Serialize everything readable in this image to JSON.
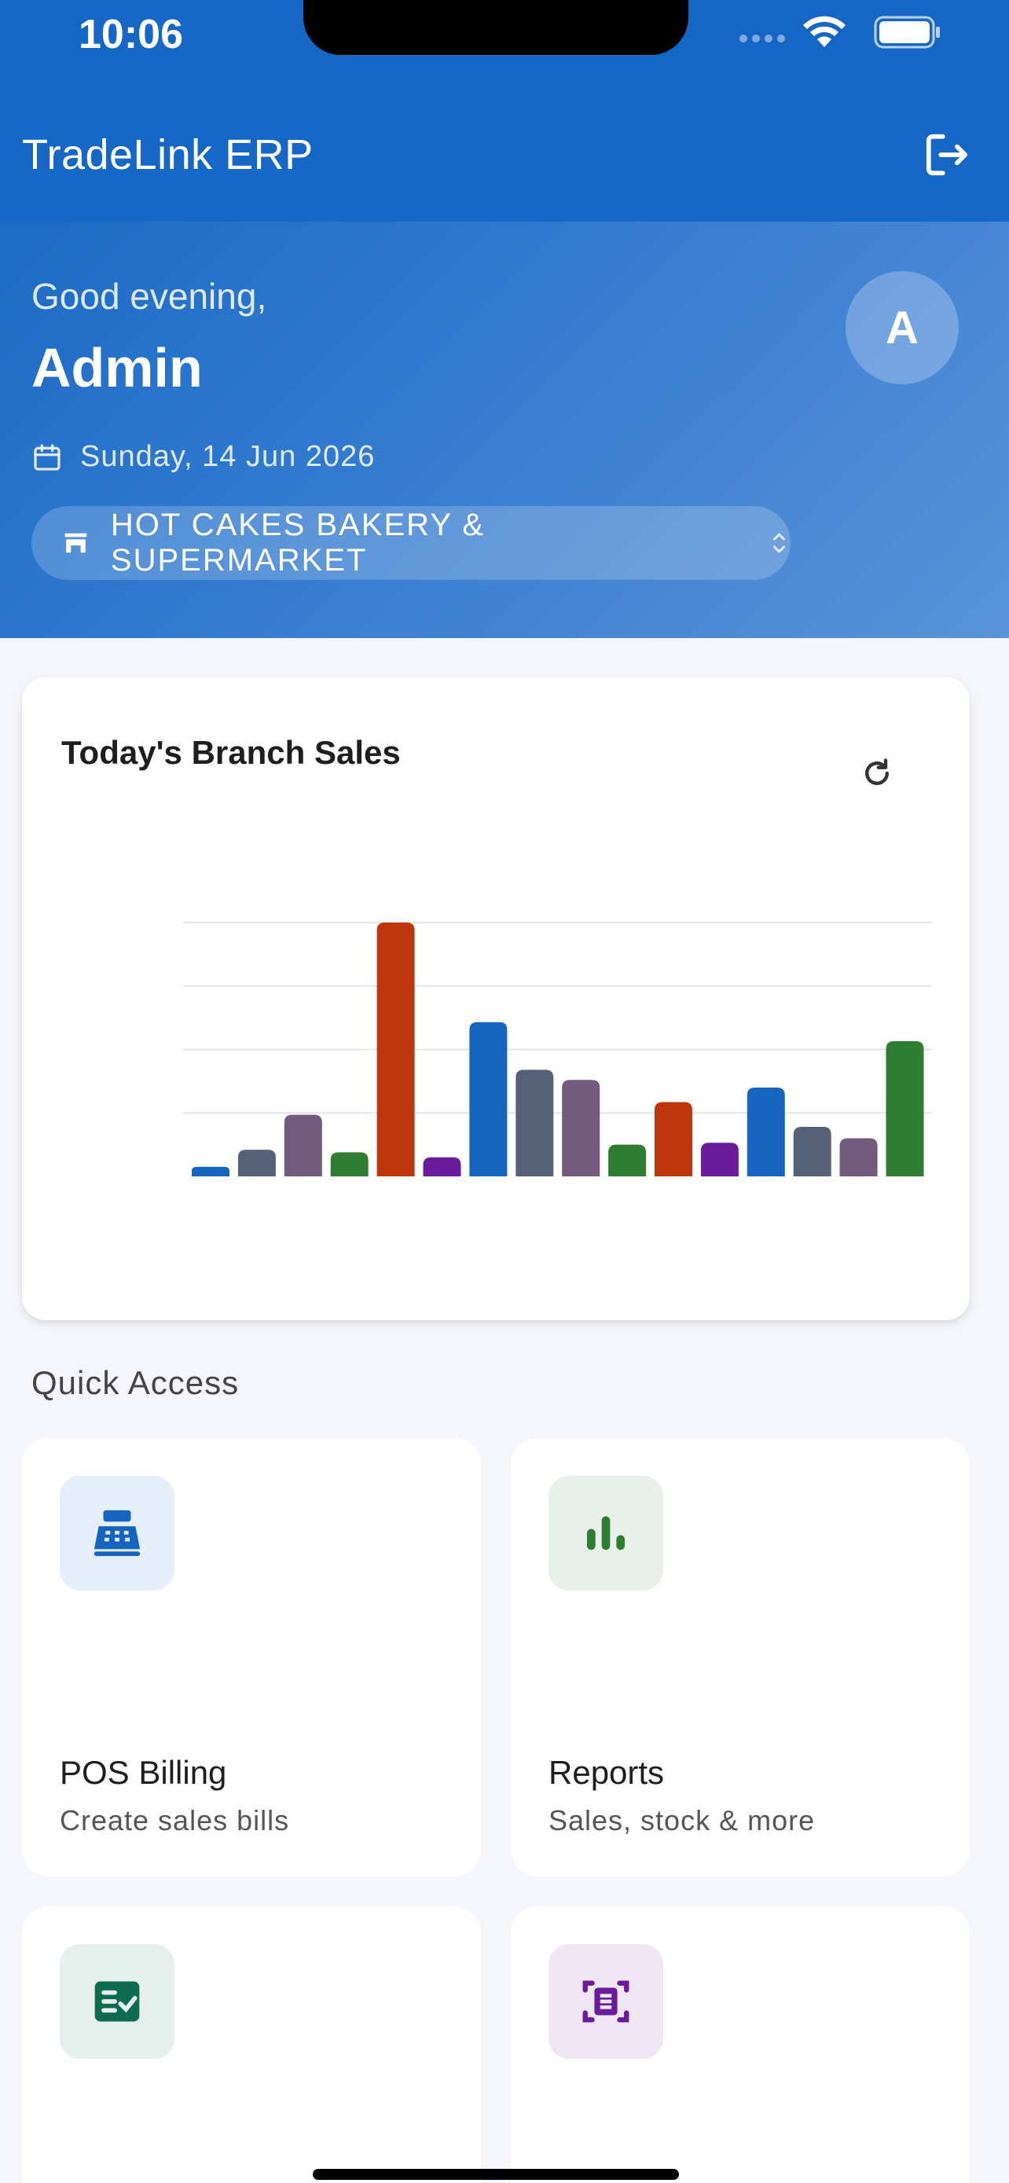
{
  "status_bar": {
    "time": "10:06"
  },
  "app_bar": {
    "title": "TradeLink ERP",
    "logout_icon": "logout-icon"
  },
  "hero": {
    "greeting": "Good evening,",
    "user_name": "Admin",
    "avatar_initial": "A",
    "date": "Sunday, 14 Jun 2026",
    "branch": "HOT CAKES BAKERY & SUPERMARKET"
  },
  "chart_card": {
    "title": "Today's Branch Sales",
    "refresh_icon": "refresh-icon"
  },
  "chart_data": {
    "type": "bar",
    "title": "Today's Branch Sales",
    "ylim": [
      0,
      4
    ],
    "grid": true,
    "values": [
      0.15,
      0.42,
      0.97,
      0.38,
      4.0,
      0.3,
      2.43,
      1.68,
      1.52,
      0.5,
      1.17,
      0.53,
      1.4,
      0.78,
      0.6,
      2.13
    ],
    "colors": [
      "#1565c0",
      "#546178",
      "#735a7c",
      "#2e7d32",
      "#bf360c",
      "#6a1b9a",
      "#1565c0",
      "#546178",
      "#735a7c",
      "#2e7d32",
      "#bf360c",
      "#6a1b9a",
      "#1565c0",
      "#546178",
      "#735a7c",
      "#2e7d32"
    ]
  },
  "quick_access": {
    "label": "Quick Access",
    "tiles": [
      {
        "title": "POS Billing",
        "subtitle": "Create sales bills",
        "icon": "cash-register-icon",
        "color": "#1565c0",
        "bg": "#e6eef9"
      },
      {
        "title": "Reports",
        "subtitle": "Sales, stock & more",
        "icon": "bar-chart-icon",
        "color": "#2e7d32",
        "bg": "#e9efe9"
      },
      {
        "title": "",
        "subtitle": "",
        "icon": "checklist-icon",
        "color": "#0d6b4f",
        "bg": "#e5f0ec"
      },
      {
        "title": "",
        "subtitle": "",
        "icon": "scan-document-icon",
        "color": "#6a1b9a",
        "bg": "#efe6f3"
      }
    ]
  }
}
